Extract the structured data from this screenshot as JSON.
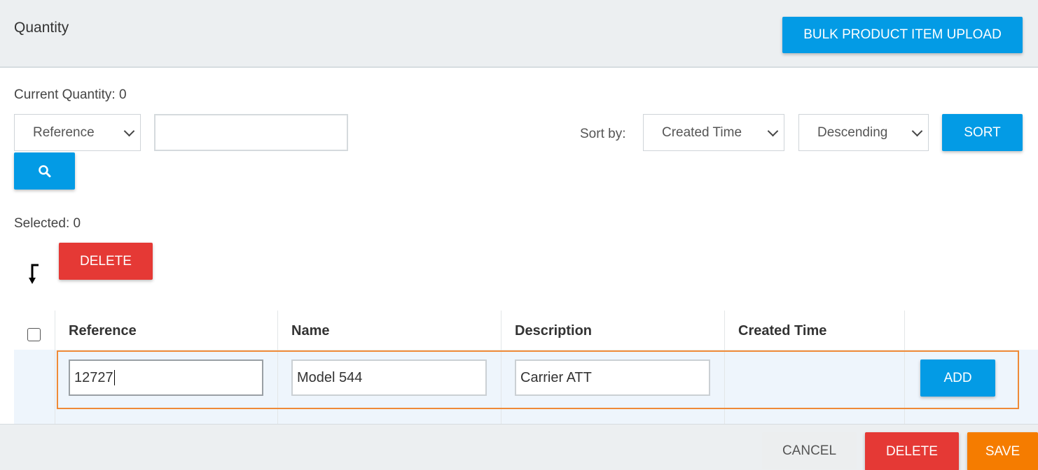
{
  "header": {
    "title": "Quantity",
    "bulk_upload_label": "BULK PRODUCT ITEM UPLOAD"
  },
  "filters": {
    "current_quantity_label": "Current Quantity: 0",
    "search_field_selected": "Reference",
    "search_value": "",
    "sort_by_label": "Sort by:",
    "sort_field_selected": "Created Time",
    "sort_order_selected": "Descending",
    "sort_button_label": "SORT"
  },
  "selection": {
    "selected_label": "Selected: 0",
    "delete_label": "DELETE"
  },
  "table": {
    "columns": [
      "Reference",
      "Name",
      "Description",
      "Created Time"
    ],
    "new_row": {
      "reference": "12727",
      "name": "Model 544",
      "description": "Carrier ATT",
      "add_label": "ADD"
    }
  },
  "footer": {
    "cancel_label": "CANCEL",
    "delete_label": "DELETE",
    "save_label": "SAVE"
  },
  "colors": {
    "primary": "#039be5",
    "danger": "#e53935",
    "warning": "#f57c00",
    "row_highlight": "#ef8a37"
  },
  "icons": {
    "search_button": "search-icon",
    "sort_direction": "sort-arrow-down-icon",
    "select_chevron": "chevron-down-icon"
  }
}
